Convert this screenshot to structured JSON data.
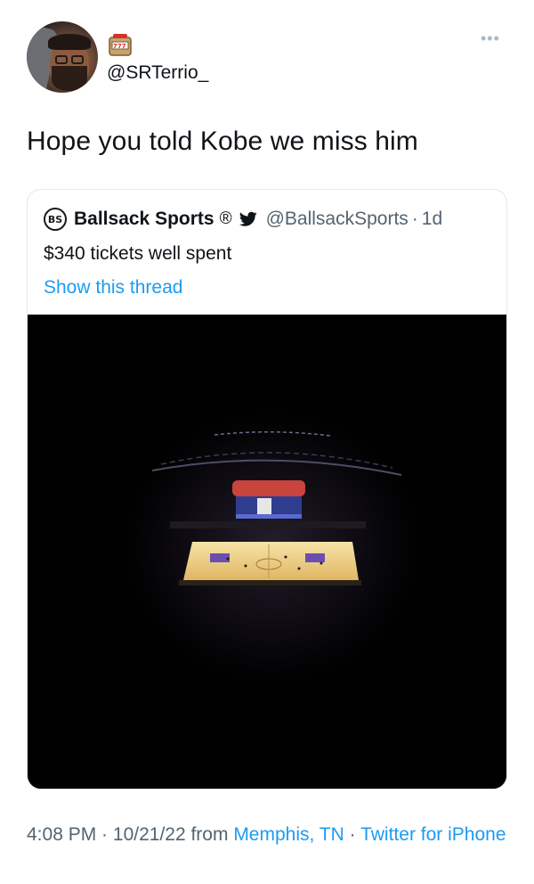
{
  "author": {
    "handle": "@SRTerrio_",
    "badge_icon": "slot-machine-icon"
  },
  "tweet": {
    "text": "Hope you told Kobe we miss him"
  },
  "quoted": {
    "logo_text": "BS",
    "name": "Ballsack Sports",
    "registered": "®",
    "handle": "@BallsackSports",
    "separator": "·",
    "time": "1d",
    "text": "$340 tickets well spent",
    "thread_link": "Show this thread",
    "image_desc_icon": "arena-photo"
  },
  "meta": {
    "time": "4:08 PM",
    "sep1": " · ",
    "date": "10/21/22",
    "from_word": " from ",
    "location": "Memphis, TN",
    "sep2": " · ",
    "client": "Twitter for iPhone"
  },
  "colors": {
    "link": "#1d9bf0",
    "muted": "#536471",
    "text": "#0f1419"
  }
}
